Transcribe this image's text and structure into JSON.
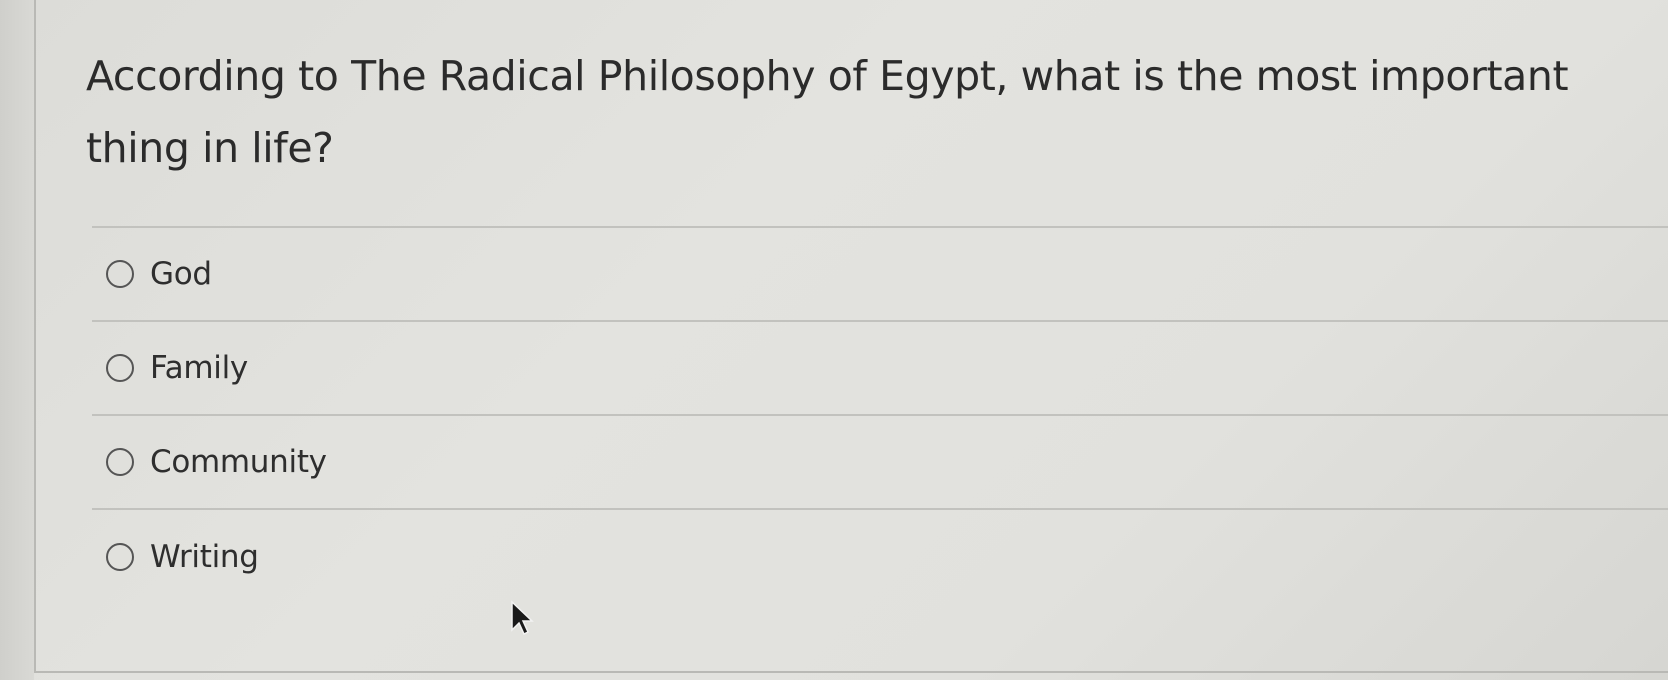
{
  "question": {
    "text": "According to The Radical Philosophy of Egypt, what is the most important thing in life?"
  },
  "options": [
    {
      "label": "God",
      "selected": false
    },
    {
      "label": "Family",
      "selected": false
    },
    {
      "label": "Community",
      "selected": false
    },
    {
      "label": "Writing",
      "selected": false
    }
  ],
  "icons": {
    "radio": "radio-unchecked-icon",
    "cursor": "mouse-pointer-icon"
  }
}
